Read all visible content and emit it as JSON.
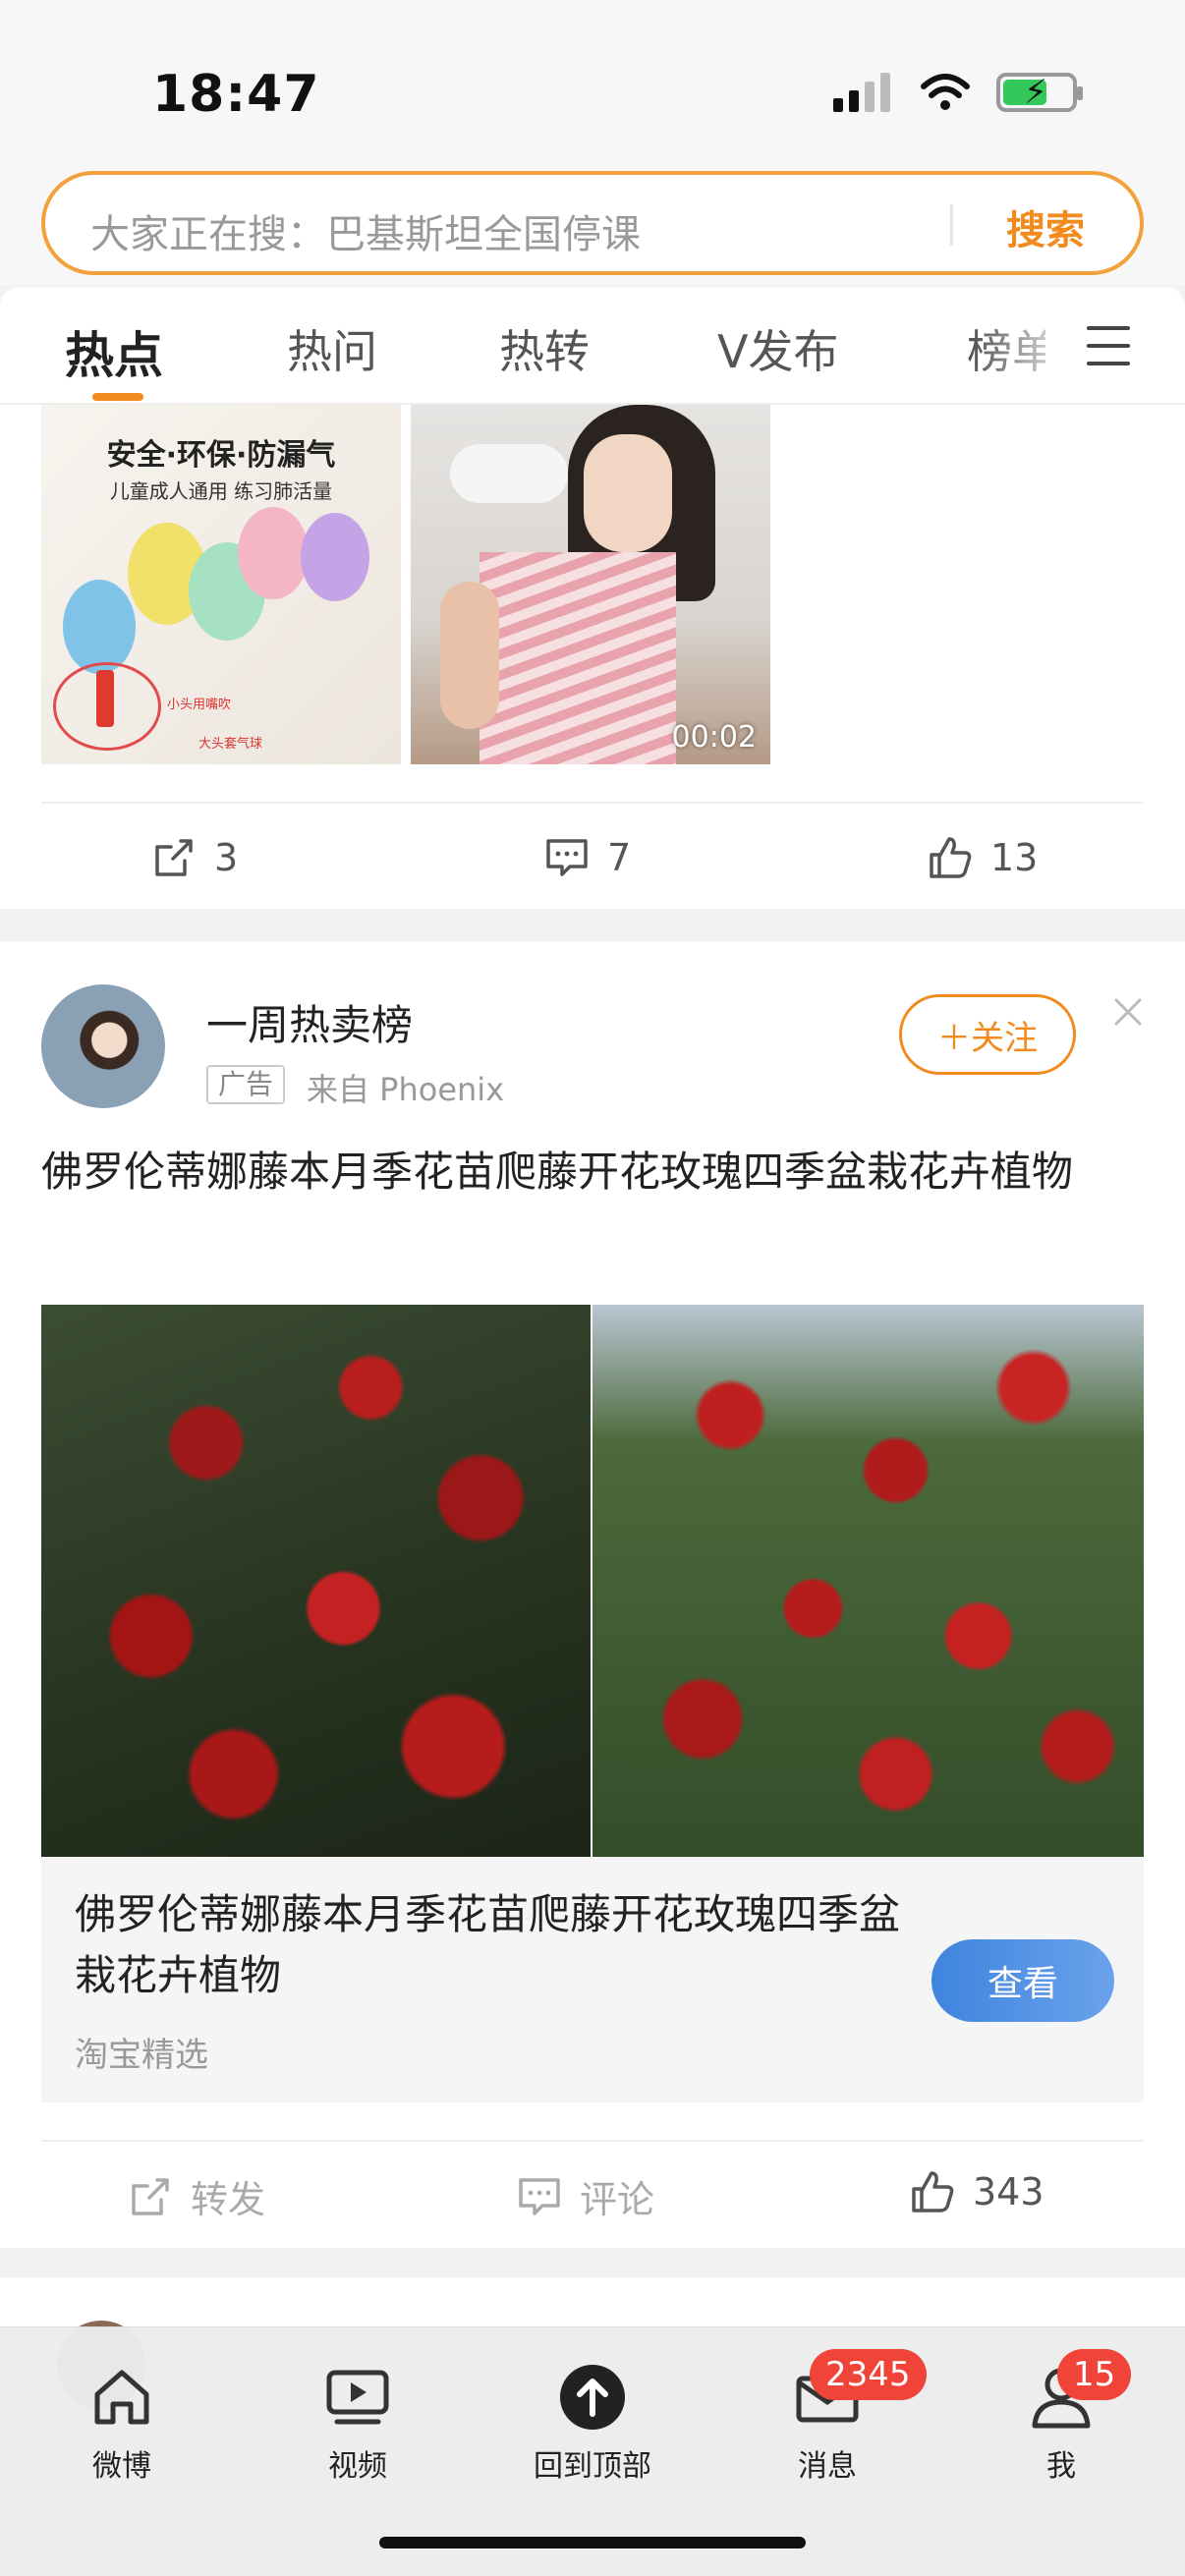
{
  "status_bar": {
    "time": "18:47"
  },
  "search": {
    "placeholder": "大家正在搜：巴基斯坦全国停课",
    "button_label": "搜索"
  },
  "tabs": [
    {
      "label": "热点",
      "active": true
    },
    {
      "label": "热问"
    },
    {
      "label": "热转"
    },
    {
      "label": "V发布"
    },
    {
      "label": "榜单"
    }
  ],
  "card1": {
    "thumb1": {
      "title": "安全·环保·防漏气",
      "subtitle": "儿童成人通用 练习肺活量",
      "caption_a": "小头用嘴吹",
      "caption_b": "大头套气球"
    },
    "thumb2": {
      "duration": "00:02"
    },
    "actions": {
      "repost": "3",
      "comment": "7",
      "like": "13"
    }
  },
  "card2": {
    "author": "一周热卖榜",
    "ad_tag": "广告",
    "source": "来自 Phoenix",
    "follow_label": "＋关注",
    "text": "佛罗伦蒂娜藤本月季花苗爬藤开花玫瑰四季盆栽花卉植物",
    "product": {
      "title": "佛罗伦蒂娜藤本月季花苗爬藤开花玫瑰四季盆栽花卉植物",
      "source": "淘宝精选",
      "button_label": "查看"
    },
    "actions": {
      "repost": "转发",
      "comment": "评论",
      "like": "343"
    }
  },
  "bottom_nav": [
    {
      "label": "微博",
      "icon": "home-icon"
    },
    {
      "label": "视频",
      "icon": "video-icon"
    },
    {
      "label": "回到顶部",
      "icon": "arrow-up-icon"
    },
    {
      "label": "消息",
      "icon": "message-icon",
      "badge": "2345"
    },
    {
      "label": "我",
      "icon": "profile-icon",
      "badge": "15"
    }
  ]
}
